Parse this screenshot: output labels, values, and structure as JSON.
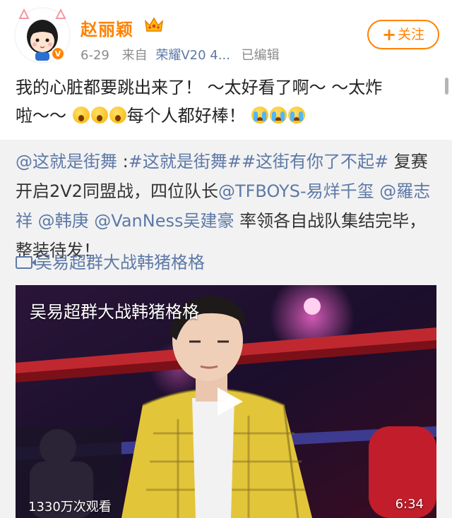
{
  "user": {
    "name": "赵丽颖",
    "date": "6-29",
    "source_prefix": "来自",
    "device": "荣耀V20 4...",
    "edited": "已编辑",
    "follow_label": "关注"
  },
  "post": {
    "line1": "我的心脏都要跳出来了！ ～太好看了啊～ ～太炸",
    "line2_start": "啦～～",
    "line2_end": "每个人都好棒！"
  },
  "repost": {
    "mention_main": "@这就是街舞",
    "colon": " :",
    "tag1": "#这就是街舞#",
    "tag2": "#这街有你了不起#",
    "text1": " 复赛开启2V2同盟战，四位队长",
    "mention1": "@TFBOYS-易烊千玺",
    "mention2": "@羅志祥",
    "mention3": "@韩庚",
    "mention4": "@VanNess吴建豪",
    "text2": " 率领各自战队集结完毕，整装待发！",
    "video_link": "吴易超群大战韩猪格格"
  },
  "video": {
    "title": "吴易超群大战韩猪格格",
    "views": "1330万次观看",
    "duration": "6:34"
  },
  "colors": {
    "accent": "#ff8200",
    "link": "#5d79a7",
    "repost_bg": "#f2f2f2"
  },
  "icons": [
    "avatar-cartoon",
    "crown-icon",
    "plus-icon",
    "shock-emoji",
    "crying-emoji",
    "video-icon",
    "play-icon"
  ]
}
